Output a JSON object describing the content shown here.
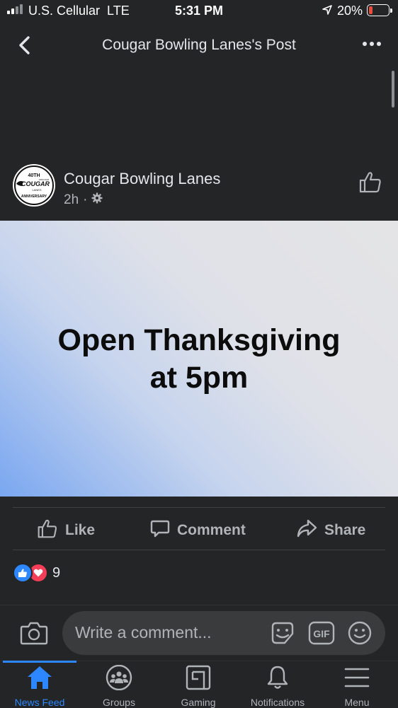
{
  "status": {
    "carrier": "U.S. Cellular",
    "network": "LTE",
    "time": "5:31 PM",
    "battery": "20%",
    "battery_level": 0.2
  },
  "header": {
    "title": "Cougar Bowling Lanes's Post",
    "back_icon": "chevron-left-icon",
    "more_icon": "more-dots-icon"
  },
  "post": {
    "page_name": "Cougar Bowling Lanes",
    "time": "2h",
    "privacy_icon": "gear-icon",
    "avatar_text": {
      "top": "40TH",
      "name": "COUGAR",
      "sub": "LANES",
      "bottom": "ANNIVERSARY",
      "small": "1983-2023"
    },
    "text_line1": "Open Thanksgiving",
    "text_line2": "at 5pm"
  },
  "actions": {
    "like": "Like",
    "comment": "Comment",
    "share": "Share"
  },
  "reactions": {
    "count": "9",
    "types": [
      "like",
      "love"
    ]
  },
  "comment_bar": {
    "placeholder": "Write a comment...",
    "gif_label": "GIF"
  },
  "tabs": [
    {
      "label": "News Feed",
      "icon": "home-icon",
      "active": true
    },
    {
      "label": "Groups",
      "icon": "groups-icon",
      "active": false
    },
    {
      "label": "Gaming",
      "icon": "gaming-icon",
      "active": false
    },
    {
      "label": "Notifications",
      "icon": "bell-icon",
      "active": false
    },
    {
      "label": "Menu",
      "icon": "menu-icon",
      "active": false
    }
  ],
  "colors": {
    "background": "#242526",
    "accent": "#2d88ff",
    "text_secondary": "#b0b3b8",
    "love": "#f33e58",
    "battery_low": "#eb4d3d"
  }
}
